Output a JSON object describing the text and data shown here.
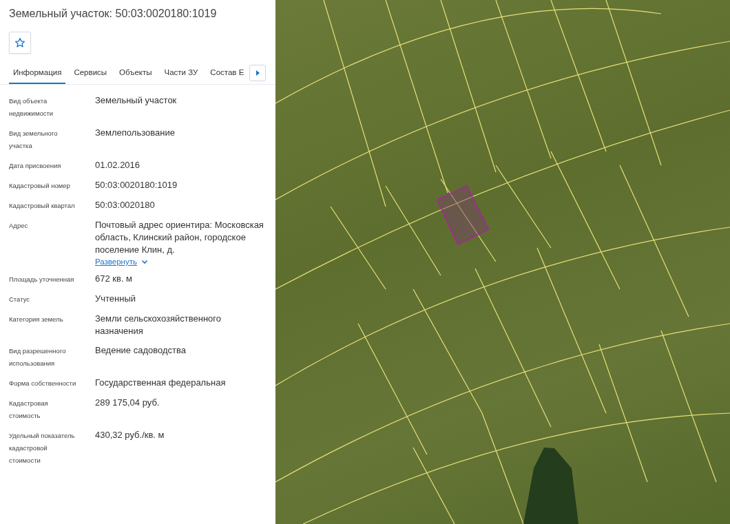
{
  "title": "Земельный участок: 50:03:0020180:1019",
  "favorite": {
    "checked": false
  },
  "tabs": [
    {
      "label": "Информация",
      "selected": true
    },
    {
      "label": "Сервисы",
      "selected": false
    },
    {
      "label": "Объекты",
      "selected": false
    },
    {
      "label": "Части ЗУ",
      "selected": false
    },
    {
      "label": "Состав Е",
      "selected": false
    }
  ],
  "fields": [
    {
      "label": "Вид объекта недвижимости",
      "value": "Земельный участок"
    },
    {
      "label": "Вид земельного участка",
      "value": "Землепользование"
    },
    {
      "label": "Дата присвоения",
      "value": "01.02.2016"
    },
    {
      "label": "Кадастровый номер",
      "value": "50:03:0020180:1019"
    },
    {
      "label": "Кадастровый квартал",
      "value": "50:03:0020180"
    },
    {
      "label": "Адрес",
      "value": "Почтовый адрес ориентира: Московская область, Клинский район, городское поселение Клин, д.",
      "expand_link": "Развернуть"
    },
    {
      "label": "Площадь уточненная",
      "value": "672 кв. м"
    },
    {
      "label": "Статус",
      "value": "Учтенный"
    },
    {
      "label": "Категория земель",
      "value": "Земли сельскохозяйственного назначения"
    },
    {
      "label": "Вид разрешенного использования",
      "value": "Ведение садоводства"
    },
    {
      "label": "Форма собственности",
      "value": "Государственная федеральная"
    },
    {
      "label": "Кадастровая стоимость",
      "value": "289 175,04 руб."
    },
    {
      "label": "Удельный показатель кадастровой стоимости",
      "value": "430,32 руб./кв. м"
    }
  ]
}
